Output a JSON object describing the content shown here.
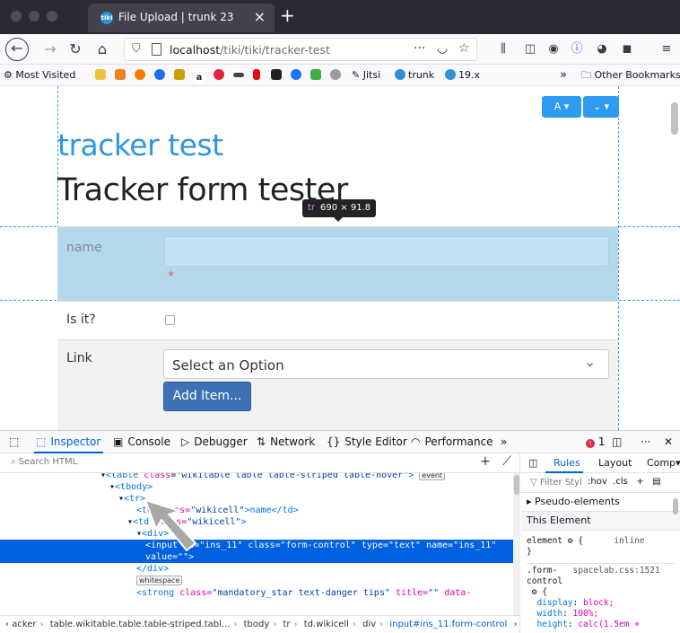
{
  "browser": {
    "tab_title": "File Upload | trunk 23",
    "tab_favicon_text": "tiki",
    "url_host": "localhost",
    "url_path": "/tiki/tiki/tracker-test",
    "url_actions": "···"
  },
  "bookmarks": {
    "most_visited": "Most Visited",
    "jitsi": "Jitsi",
    "trunk": "trunk",
    "v19": "19.x",
    "overflow": "»",
    "other": "Other Bookmarks"
  },
  "page": {
    "site_title": "tracker test",
    "form_title": "Tracker form tester",
    "tooltip_tag": "tr",
    "tooltip_size": "690 × 91.8",
    "tool_btn1": "A",
    "tool_btn2": "⌄",
    "fields": {
      "name_label": "name",
      "required_mark": "*",
      "isit_label": "Is it?",
      "link_label": "Link",
      "select_value": "Select an Option",
      "add_button": "Add Item..."
    }
  },
  "devtools": {
    "tabs": {
      "inspector": "Inspector",
      "console": "Console",
      "debugger": "Debugger",
      "network": "Network",
      "style_editor": "Style Editor",
      "performance": "Performance"
    },
    "error_count": "1",
    "search_placeholder": "Search HTML",
    "tree": {
      "l1_tag": "<table",
      "l1_attr": "class",
      "l1_val": "\"wikitable table table-striped table-hover\"",
      "l1_close": ">",
      "l1_badge": "event",
      "l2": "<tbody>",
      "l3": "<tr>",
      "l4_open": "<td",
      "l4_attr": "class=",
      "l4_val": "\"wikicell\"",
      "l4_rest": ">name</td>",
      "l5_open": "<td",
      "l5_attr": "class=",
      "l5_val": "\"wikicell\"",
      "l5_rest": ">",
      "l6": "<div>",
      "l7a": "<input id=\"ins_11\" class=\"form-control\" type=\"text\" name=\"ins_11\"",
      "l7b": "value=\"\">",
      "l8": "</div>",
      "l9_badge": "whitespace",
      "l10_open": "<strong",
      "l10_attr": "class=",
      "l10_val": "\"mandatory_star text-danger tips\"",
      "l10_attr2": "title=",
      "l10_val2": "\"\"",
      "l10_rest": "data-"
    },
    "breadcrumbs": {
      "c1": "acker",
      "c2": "table.wikitable.table.table-striped.tabl...",
      "c3": "tbody",
      "c4": "tr",
      "c5": "td.wikicell",
      "c6": "div",
      "c7": "input#ins_11.form-control"
    },
    "rules": {
      "tab_rules": "Rules",
      "tab_layout": "Layout",
      "tab_computed": "Comp",
      "filter_placeholder": "Filter Styl",
      "filter_hov": ":hov",
      "filter_cls": ".cls",
      "pseudo": "Pseudo-elements",
      "this_element": "This Element",
      "element_selector": "element",
      "element_open": "{",
      "element_source": "inline",
      "element_close": "}",
      "selector2a": ".form-",
      "selector2b": "control",
      "source2": "spacelab.css:1521",
      "brace2": "{",
      "p1_name": "display",
      "p1_val": "block;",
      "p2_name": "width",
      "p2_val": "100%;",
      "p3_name": "height",
      "p3_val": "calc(1.5em +"
    }
  }
}
